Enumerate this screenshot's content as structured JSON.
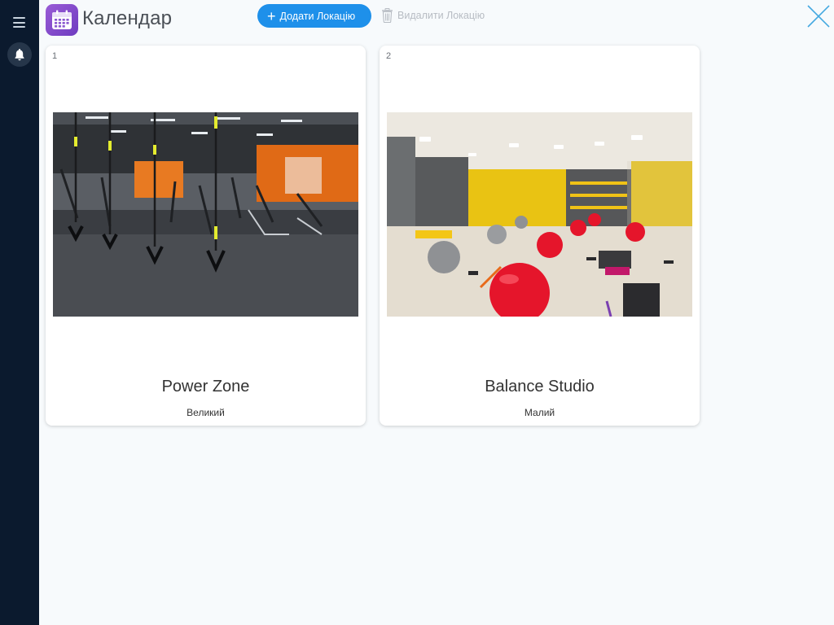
{
  "app": {
    "title": "Календар",
    "icon": "calendar-icon",
    "accent_color": "#1e90ea",
    "sidebar_color": "#0b1a2e"
  },
  "toolbar": {
    "add_label": "Додати Локацію",
    "delete_label": "Видалити Локацію"
  },
  "sidebar": {
    "menu_icon": "menu-icon",
    "notification_icon": "bell-icon"
  },
  "locations": [
    {
      "index": "1",
      "name": "Power Zone",
      "size": "Великий",
      "image": "gym-room-photo"
    },
    {
      "index": "2",
      "name": "Balance Studio",
      "size": "Малий",
      "image": "fitness-studio-photo"
    }
  ]
}
